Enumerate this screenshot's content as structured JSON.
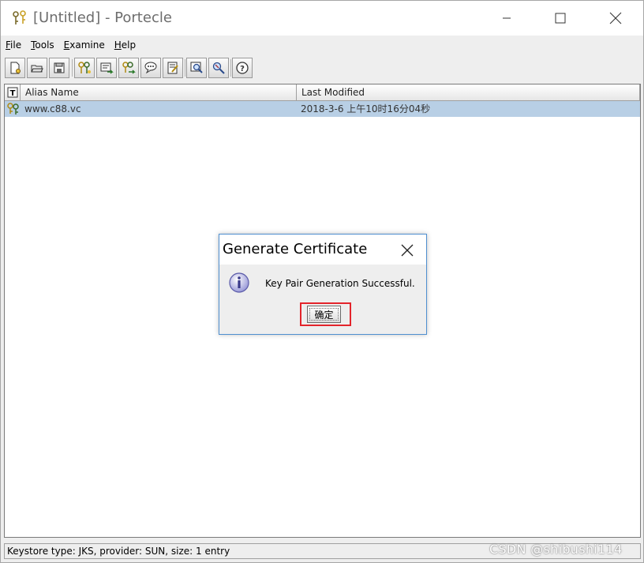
{
  "window": {
    "title": "[Untitled] - Portecle",
    "icon": "portecle-app-icon"
  },
  "menu": {
    "items": [
      {
        "label": "File"
      },
      {
        "label": "Tools"
      },
      {
        "label": "Examine"
      },
      {
        "label": "Help"
      }
    ]
  },
  "toolbar": {
    "buttons": [
      {
        "icon": "new-keystore-icon"
      },
      {
        "icon": "open-keystore-icon"
      },
      {
        "icon": "save-keystore-icon"
      },
      {
        "icon": "generate-key-pair-icon"
      },
      {
        "icon": "import-trusted-cert-icon"
      },
      {
        "icon": "import-key-pair-icon"
      },
      {
        "icon": "set-password-icon"
      },
      {
        "icon": "keystore-report-icon"
      },
      {
        "icon": "examine-certificate-icon"
      },
      {
        "icon": "examine-crl-icon"
      },
      {
        "icon": "help-icon"
      }
    ]
  },
  "table": {
    "columns": {
      "type": "T",
      "alias": "Alias Name",
      "modified": "Last Modified"
    },
    "rows": [
      {
        "type_icon": "key-pair-entry-icon",
        "alias": "www.c88.vc",
        "modified": "2018-3-6 上午10时16分04秒",
        "selected": true
      }
    ]
  },
  "status": {
    "text": "Keystore type: JKS, provider: SUN, size: 1 entry"
  },
  "watermark": {
    "text": "CSDN @shibushi114"
  },
  "dialog": {
    "title": "Generate Certificate",
    "message": "Key Pair Generation Successful.",
    "ok_label": "确定",
    "icon": "info-icon"
  },
  "colors": {
    "selection": "#b8cfe5",
    "dialog_border": "#4f8fd0",
    "highlight_box": "#e3242b"
  }
}
